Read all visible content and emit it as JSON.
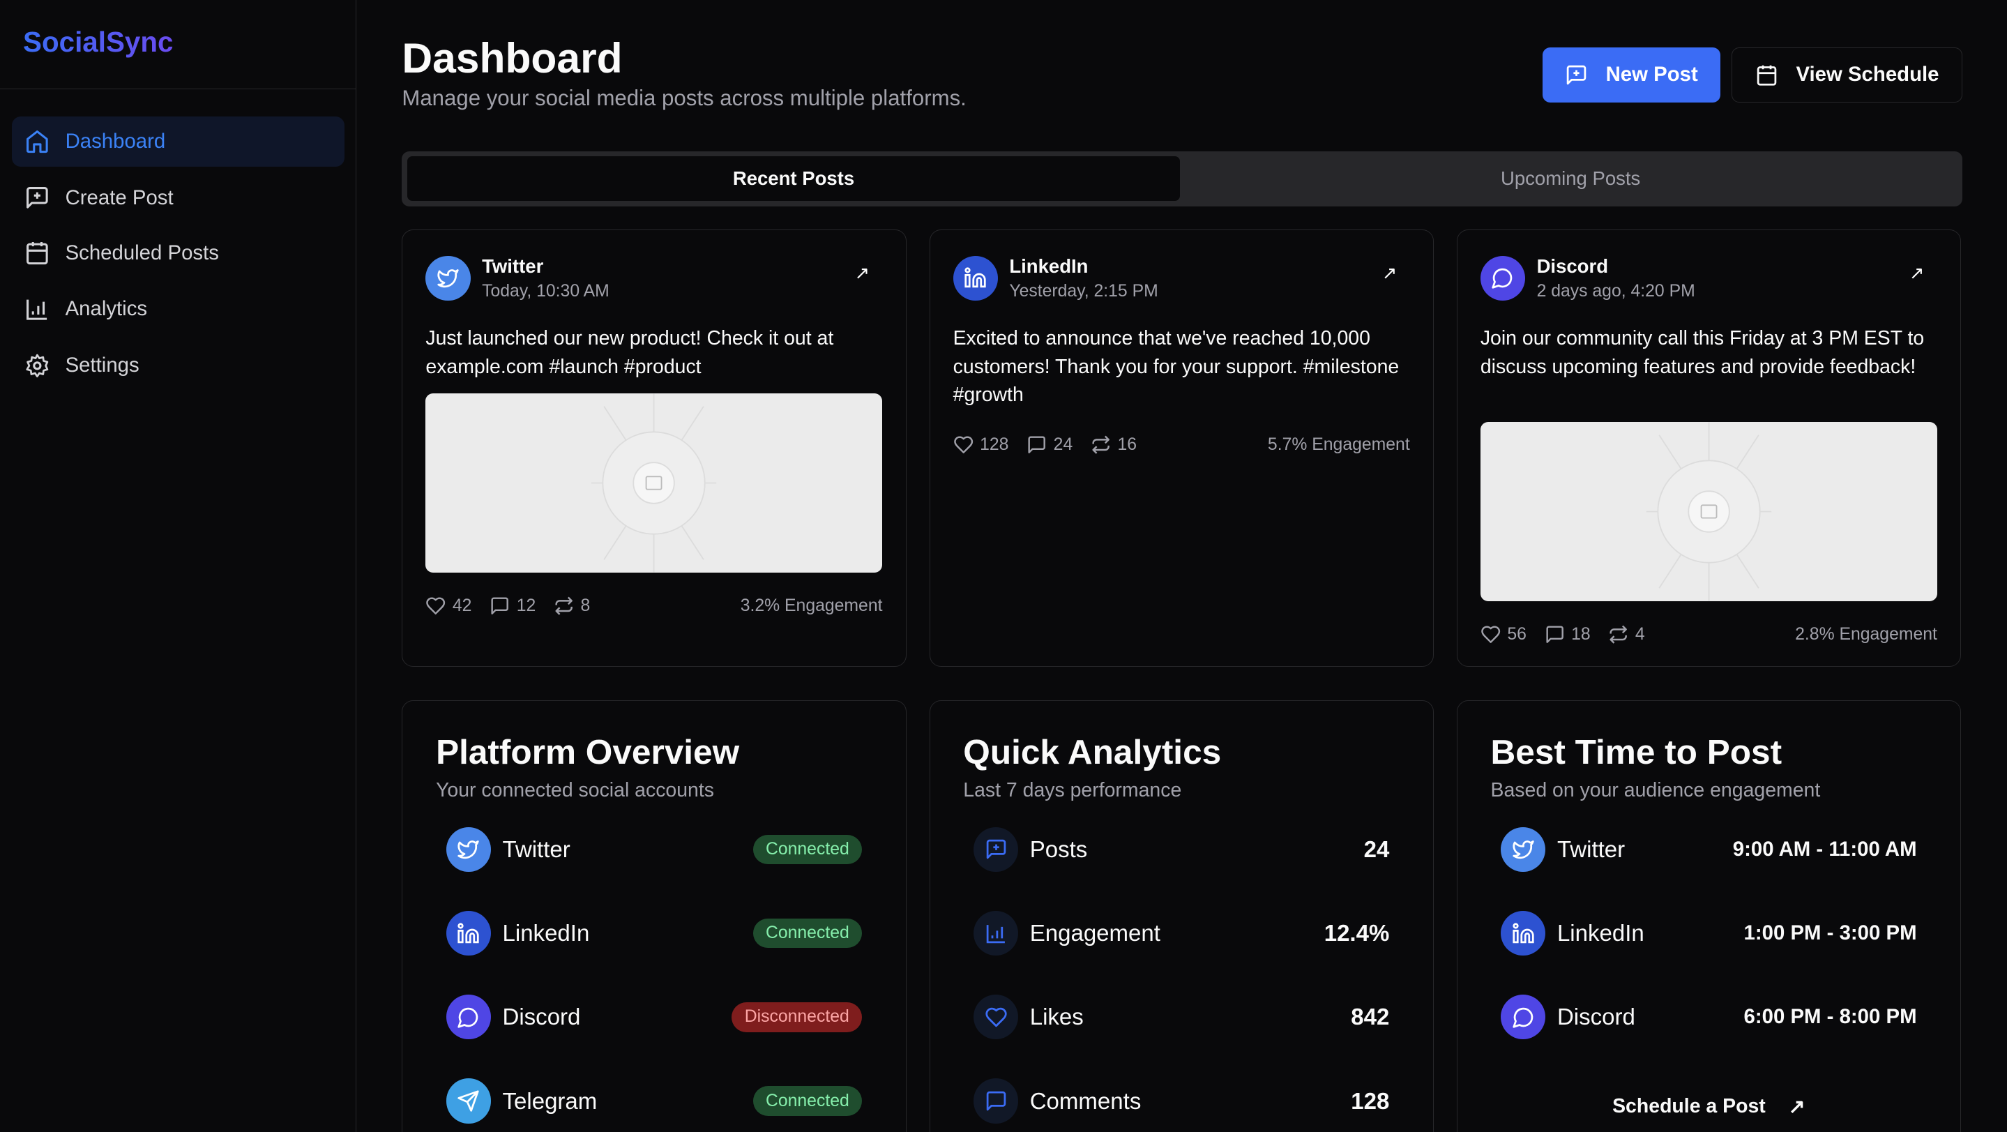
{
  "app": {
    "name": "SocialSync"
  },
  "sidebar": {
    "items": [
      {
        "label": "Dashboard",
        "icon": "home-icon",
        "active": true
      },
      {
        "label": "Create Post",
        "icon": "message-plus-icon"
      },
      {
        "label": "Scheduled Posts",
        "icon": "calendar-icon"
      },
      {
        "label": "Analytics",
        "icon": "bar-chart-icon"
      },
      {
        "label": "Settings",
        "icon": "gear-icon"
      }
    ]
  },
  "header": {
    "title": "Dashboard",
    "subtitle": "Manage your social media posts across multiple platforms.",
    "new_post": "New Post",
    "view_schedule": "View Schedule"
  },
  "tabs": [
    {
      "label": "Recent Posts",
      "active": true
    },
    {
      "label": "Upcoming Posts"
    }
  ],
  "posts": [
    {
      "platform": "Twitter",
      "time": "Today, 10:30 AM",
      "text": "Just launched our new product! Check it out at example.com #launch #product",
      "has_image": true,
      "likes": "42",
      "comments": "12",
      "shares": "8",
      "engagement": "3.2% Engagement",
      "color": "#4a86e8"
    },
    {
      "platform": "LinkedIn",
      "time": "Yesterday, 2:15 PM",
      "text": "Excited to announce that we've reached 10,000 customers! Thank you for your support. #milestone #growth",
      "has_image": false,
      "likes": "128",
      "comments": "24",
      "shares": "16",
      "engagement": "5.7% Engagement",
      "color": "#2d52d1"
    },
    {
      "platform": "Discord",
      "time": "2 days ago, 4:20 PM",
      "text": "Join our community call this Friday at 3 PM EST to discuss upcoming features and provide feedback!",
      "has_image": true,
      "likes": "56",
      "comments": "18",
      "shares": "4",
      "engagement": "2.8% Engagement",
      "color": "#4f46e5"
    }
  ],
  "platform_overview": {
    "title": "Platform Overview",
    "subtitle": "Your connected social accounts",
    "items": [
      {
        "name": "Twitter",
        "status": "Connected",
        "color": "#4a86e8"
      },
      {
        "name": "LinkedIn",
        "status": "Connected",
        "color": "#2d52d1"
      },
      {
        "name": "Discord",
        "status": "Disconnected",
        "color": "#4f46e5"
      },
      {
        "name": "Telegram",
        "status": "Connected",
        "color": "#3ea0e4"
      }
    ]
  },
  "quick_analytics": {
    "title": "Quick Analytics",
    "subtitle": "Last 7 days performance",
    "items": [
      {
        "label": "Posts",
        "value": "24"
      },
      {
        "label": "Engagement",
        "value": "12.4%"
      },
      {
        "label": "Likes",
        "value": "842"
      },
      {
        "label": "Comments",
        "value": "128"
      }
    ]
  },
  "best_time": {
    "title": "Best Time to Post",
    "subtitle": "Based on your audience engagement",
    "items": [
      {
        "name": "Twitter",
        "time": "9:00 AM - 11:00 AM",
        "color": "#4a86e8"
      },
      {
        "name": "LinkedIn",
        "time": "1:00 PM - 3:00 PM",
        "color": "#2d52d1"
      },
      {
        "name": "Discord",
        "time": "6:00 PM - 8:00 PM",
        "color": "#4f46e5"
      }
    ],
    "action": "Schedule a Post"
  }
}
